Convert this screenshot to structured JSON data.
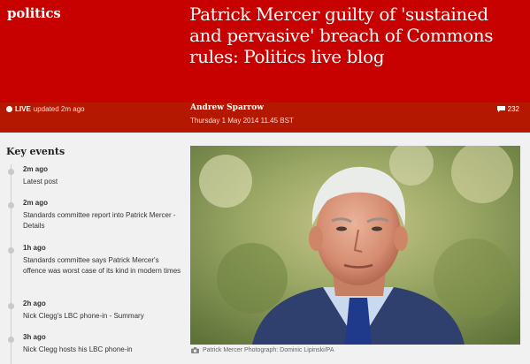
{
  "header": {
    "section": "politics",
    "headline": "Patrick Mercer guilty of 'sustained and pervasive' breach of Commons rules: Politics live blog"
  },
  "meta": {
    "live_label": "LIVE",
    "updated": "updated 2m ago",
    "author": "Andrew Sparrow",
    "date": "Thursday 1 May 2014 11.45 BST",
    "comments_count": "232",
    "comment_icon": "speech-bubble-icon"
  },
  "key_events": {
    "title": "Key events",
    "items": [
      {
        "time": "2m ago",
        "text": "Latest post"
      },
      {
        "time": "2m ago",
        "text": "Standards committee report into Patrick Mercer - Details"
      },
      {
        "time": "1h ago",
        "text": "Standards committee says Patrick Mercer's offence was worst case of its kind in modern times"
      },
      {
        "time": "2h ago",
        "text": "Nick Clegg's LBC phone-in - Summary"
      },
      {
        "time": "3h ago",
        "text": "Nick Clegg hosts his LBC phone-in"
      }
    ]
  },
  "photo": {
    "caption": "Patrick Mercer Photograph: Dominic Lipinski/PA",
    "caption_icon": "camera-icon"
  },
  "colors": {
    "header_red": "#c70000",
    "metabar_red": "#b51800",
    "background": "#f1f1f1"
  }
}
